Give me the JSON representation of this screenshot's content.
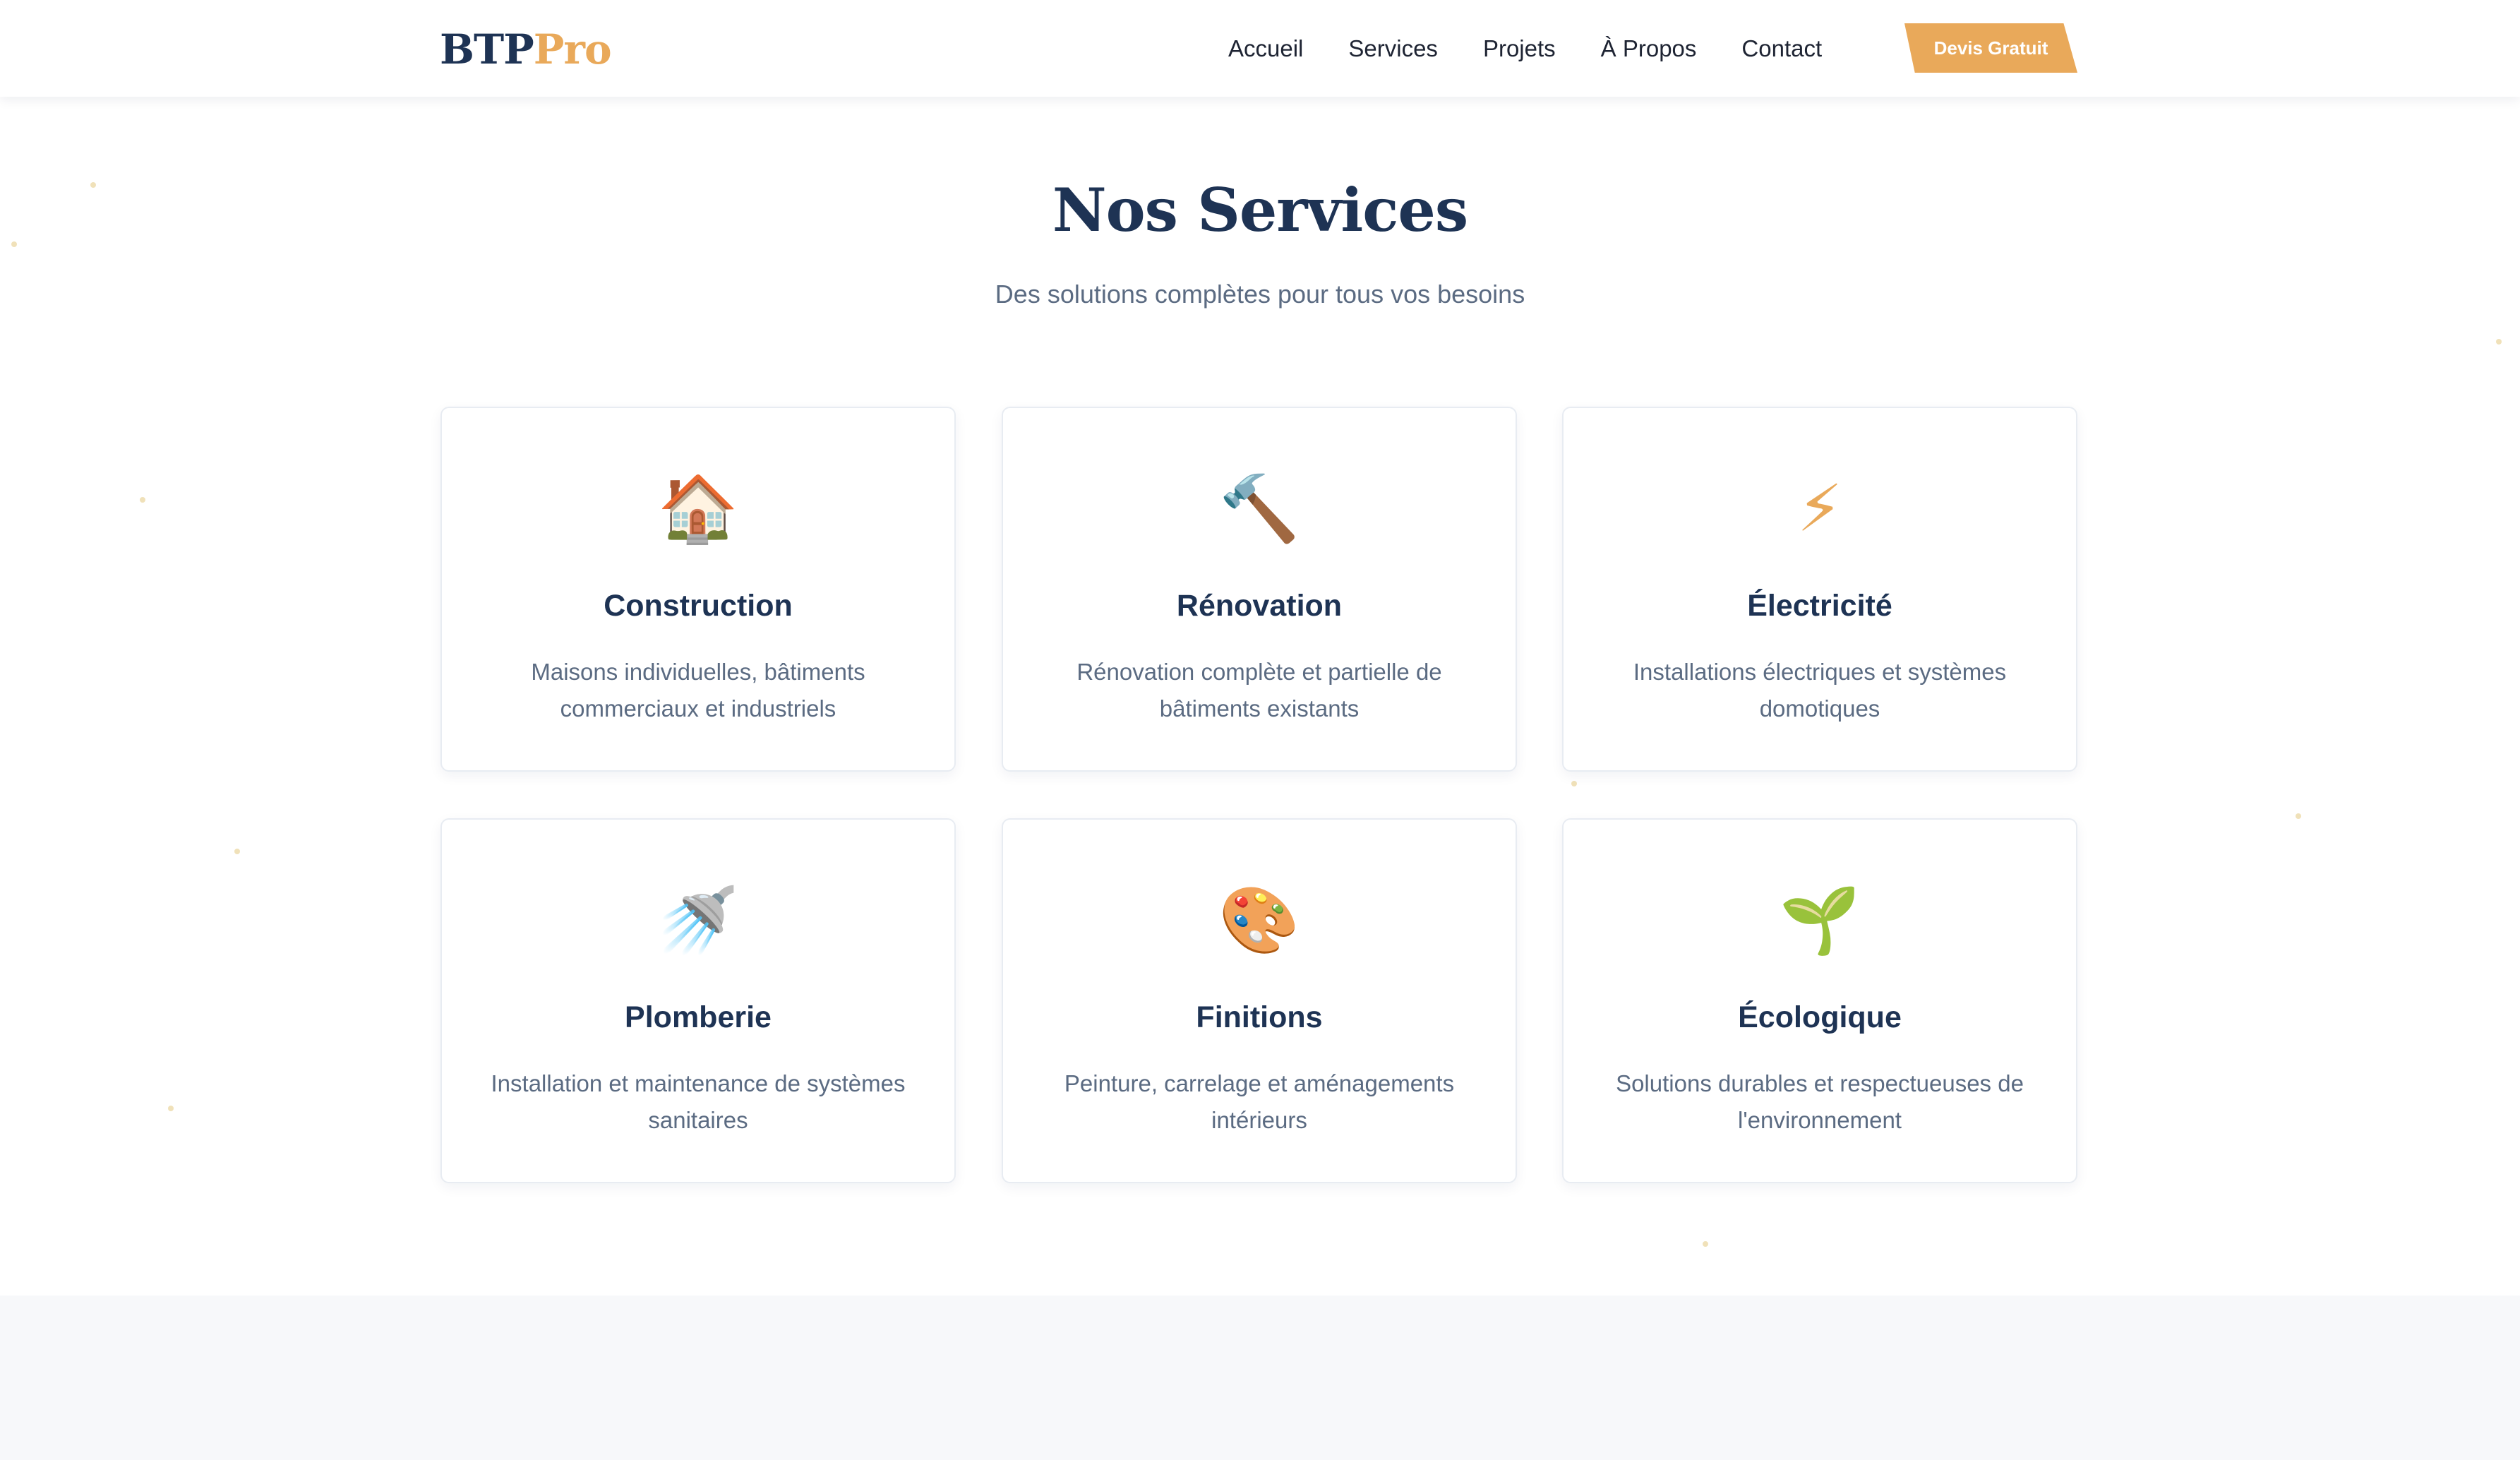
{
  "brand": {
    "part1": "BTP",
    "part2": "Pro",
    "color_primary": "#1e3354",
    "color_accent": "#e9a95a"
  },
  "nav": {
    "items": [
      "Accueil",
      "Services",
      "Projets",
      "À Propos",
      "Contact"
    ],
    "cta": "Devis Gratuit"
  },
  "section": {
    "title": "Nos Services",
    "subtitle": "Des solutions complètes pour tous vos besoins"
  },
  "services": [
    {
      "icon": "🏠",
      "icon_name": "house-icon",
      "title": "Construction",
      "desc": "Maisons individuelles, bâtiments commerciaux et industriels"
    },
    {
      "icon": "🔨",
      "icon_name": "hammer-icon",
      "title": "Rénovation",
      "desc": "Rénovation complète et partielle de bâtiments existants"
    },
    {
      "icon": "⚡",
      "icon_name": "lightning-icon",
      "title": "Électricité",
      "desc": "Installations électriques et systèmes domotiques"
    },
    {
      "icon": "🚿",
      "icon_name": "shower-icon",
      "title": "Plomberie",
      "desc": "Installation et maintenance de systèmes sanitaires"
    },
    {
      "icon": "🎨",
      "icon_name": "palette-icon",
      "title": "Finitions",
      "desc": "Peinture, carrelage et aménagements intérieurs"
    },
    {
      "icon": "🌱",
      "icon_name": "seedling-icon",
      "title": "Écologique",
      "desc": "Solutions durables et respectueuses de l'environnement"
    }
  ]
}
